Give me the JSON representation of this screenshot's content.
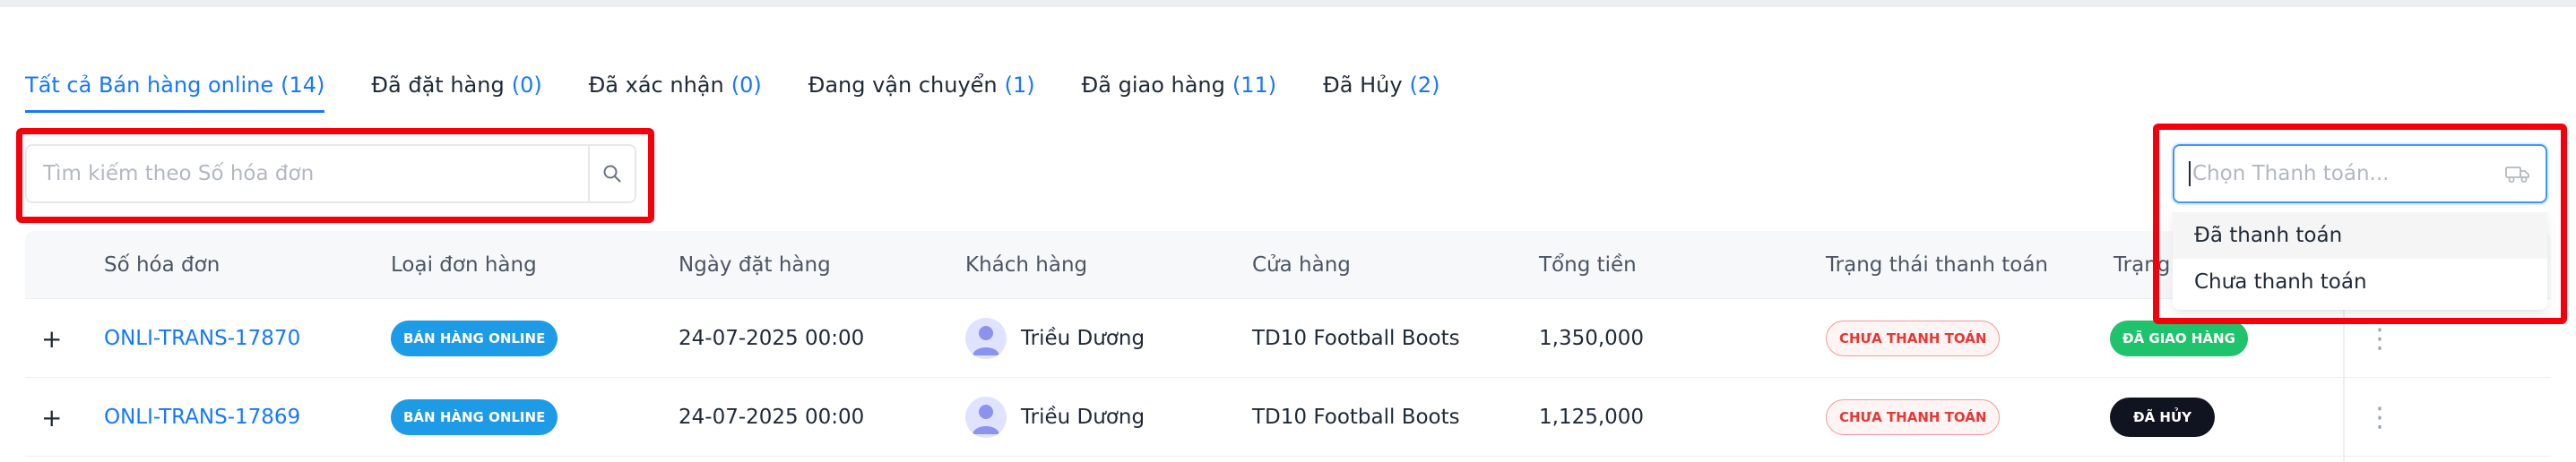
{
  "tabs": [
    {
      "label": "Tất cả Bán hàng online",
      "count": "(14)"
    },
    {
      "label": "Đã đặt hàng",
      "count": "(0)"
    },
    {
      "label": "Đã xác nhận",
      "count": "(0)"
    },
    {
      "label": "Đang vận chuyển",
      "count": "(1)"
    },
    {
      "label": "Đã giao hàng",
      "count": "(11)"
    },
    {
      "label": "Đã Hủy",
      "count": "(2)"
    }
  ],
  "search": {
    "placeholder": "Tìm kiếm theo Số hóa đơn",
    "icon": "search-icon"
  },
  "payment_filter": {
    "placeholder": "Chọn Thanh toán...",
    "icon": "truck-icon",
    "options": [
      "Đã thanh toán",
      "Chưa thanh toán"
    ]
  },
  "table": {
    "columns": [
      "Số hóa đơn",
      "Loại đơn hàng",
      "Ngày đặt hàng",
      "Khách hàng",
      "Cửa hàng",
      "Tổng tiền",
      "Trạng thái thanh toán",
      "Trạng"
    ],
    "rows": [
      {
        "expand": "+",
        "invoice": "ONLI-TRANS-17870",
        "type": "BÁN HÀNG ONLINE",
        "date": "24-07-2025 00:00",
        "customer": "Triều Dương",
        "store": "TD10 Football Boots",
        "total": "1,350,000",
        "payment_status": "CHƯA THANH TOÁN",
        "status": "ĐÃ GIAO HÀNG",
        "more": "⋮"
      },
      {
        "expand": "+",
        "invoice": "ONLI-TRANS-17869",
        "type": "BÁN HÀNG ONLINE",
        "date": "24-07-2025 00:00",
        "customer": "Triều Dương",
        "store": "TD10 Football Boots",
        "total": "1,125,000",
        "payment_status": "CHƯA THANH TOÁN",
        "status": "ĐÃ HỦY",
        "more": "⋮"
      }
    ]
  },
  "colors": {
    "accent": "#1677ff",
    "highlight": "#f5000a",
    "delivered": "#1fc36b",
    "cancelled": "#0f1420",
    "unpaid": "#e53935"
  }
}
